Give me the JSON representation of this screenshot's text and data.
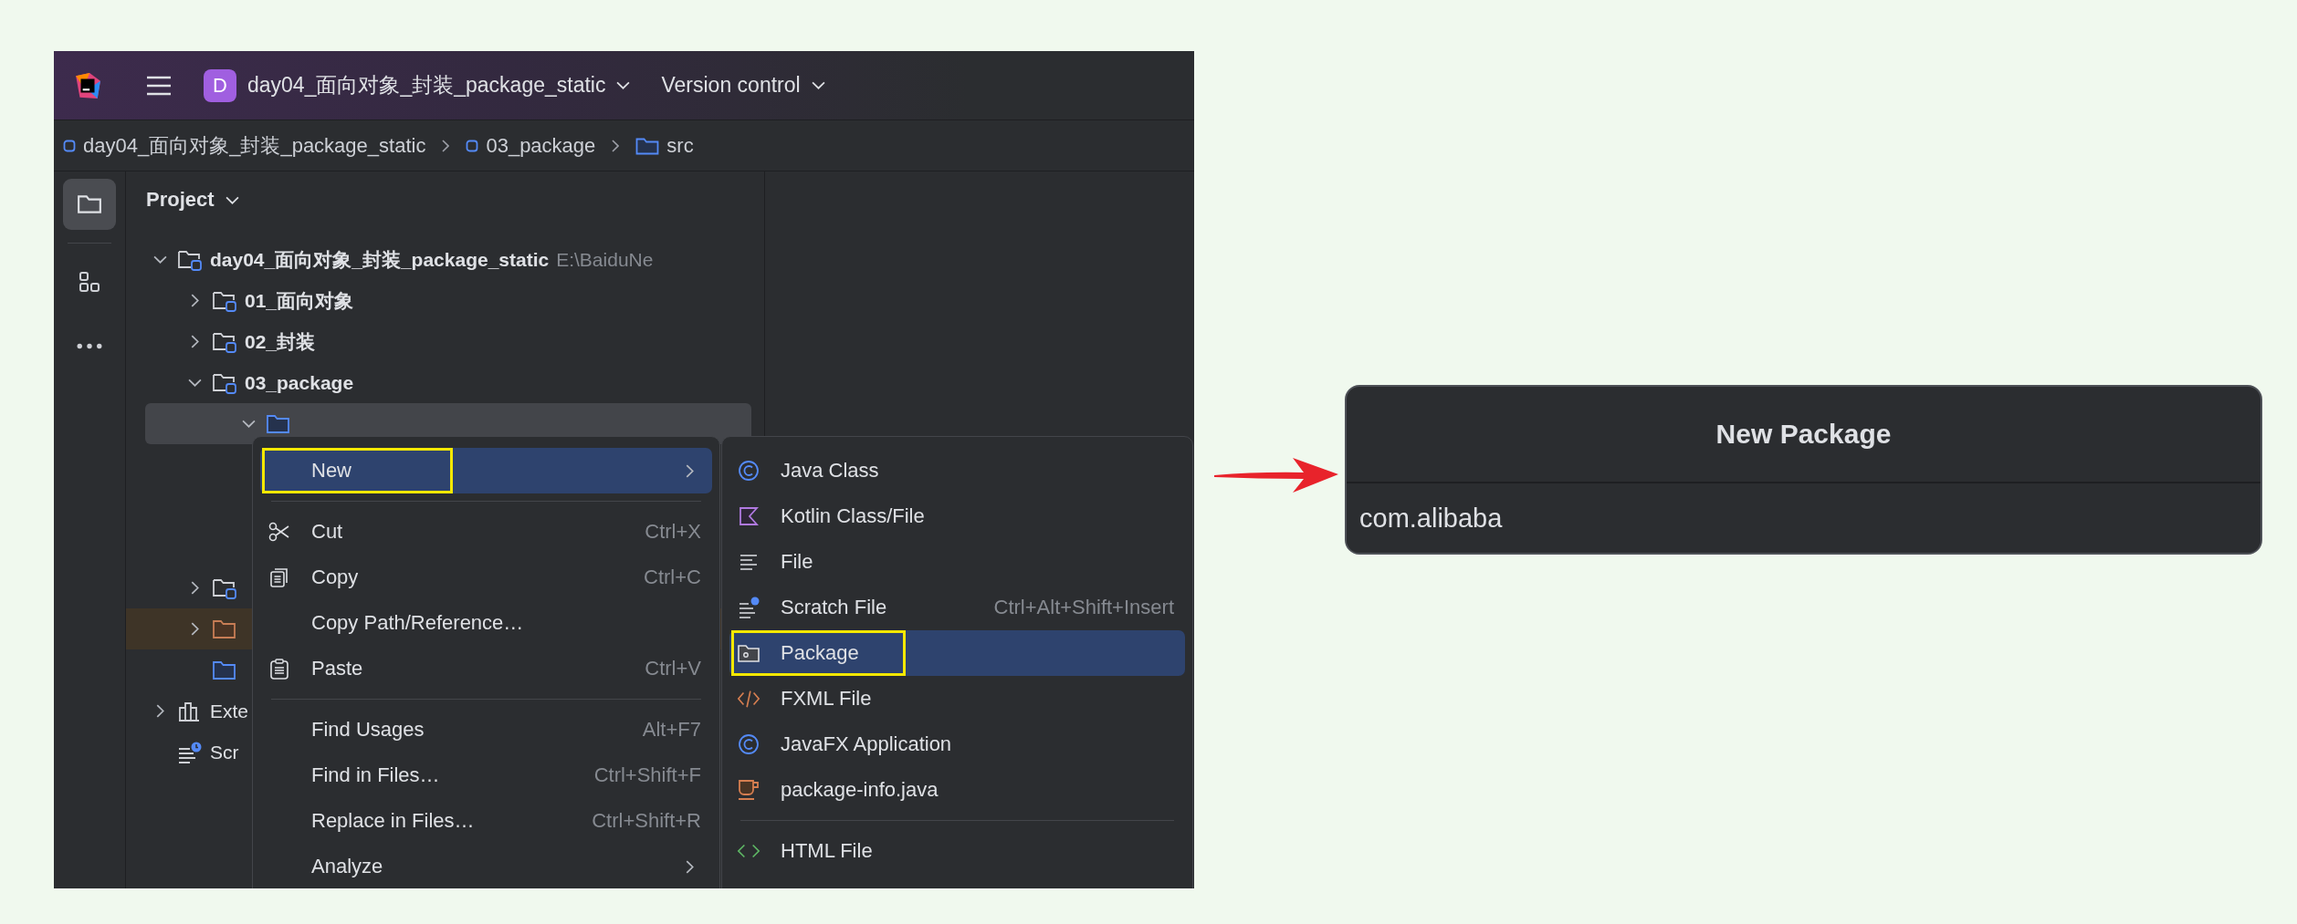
{
  "toolbar": {
    "project_badge": "D",
    "project_name": "day04_面向对象_封装_package_static",
    "vcs": "Version control"
  },
  "breadcrumbs": [
    {
      "label": "day04_面向对象_封装_package_static",
      "kind": "module"
    },
    {
      "label": "03_package",
      "kind": "module"
    },
    {
      "label": "src",
      "kind": "source"
    }
  ],
  "tool_strip": [
    {
      "kind": "project",
      "selected": true
    },
    {
      "kind": "structure",
      "selected": false
    },
    {
      "kind": "more",
      "selected": false
    }
  ],
  "panel": {
    "title": "Project"
  },
  "tree": [
    {
      "label": "day04_面向对象_封装_package_static",
      "path": "E:\\BaiduNe",
      "kind": "module",
      "expanded": true,
      "selected": false,
      "children": [
        {
          "label": "01_面向对象",
          "kind": "module",
          "expanded": false,
          "selected": false
        },
        {
          "label": "02_封装",
          "kind": "module",
          "expanded": false,
          "selected": false
        },
        {
          "label": "03_package",
          "kind": "module",
          "expanded": true,
          "selected": false,
          "children": [
            {
              "kind": "source",
              "expanded": true,
              "selected": true
            }
          ]
        },
        {
          "kind": "module",
          "expanded": false,
          "selected": false
        },
        {
          "kind": "excluded",
          "expanded": false,
          "selected": false,
          "highlighted": true
        },
        {
          "kind": "source",
          "selected": false
        }
      ]
    },
    {
      "label": "Exte",
      "kind": "libraries",
      "expanded": false,
      "selected": false
    },
    {
      "label": "Scr",
      "kind": "scratches",
      "selected": false
    }
  ],
  "context_menu": {
    "items": [
      {
        "kind": "plain",
        "label": "New",
        "submenu": true,
        "selected": true,
        "annotated": true
      },
      {
        "kind": "separator"
      },
      {
        "kind": "cut",
        "label": "Cut",
        "shortcut": "Ctrl+X",
        "submenu": false,
        "selected": false,
        "annotated": false
      },
      {
        "kind": "copy",
        "label": "Copy",
        "shortcut": "Ctrl+C",
        "submenu": false,
        "selected": false,
        "annotated": false
      },
      {
        "kind": "plain",
        "label": "Copy Path/Reference…",
        "submenu": false,
        "selected": false,
        "annotated": false
      },
      {
        "kind": "paste",
        "label": "Paste",
        "shortcut": "Ctrl+V",
        "submenu": false,
        "selected": false,
        "annotated": false
      },
      {
        "kind": "separator"
      },
      {
        "kind": "plain",
        "label": "Find Usages",
        "shortcut": "Alt+F7",
        "submenu": false,
        "selected": false,
        "annotated": false
      },
      {
        "kind": "plain",
        "label": "Find in Files…",
        "shortcut": "Ctrl+Shift+F",
        "submenu": false,
        "selected": false,
        "annotated": false
      },
      {
        "kind": "plain",
        "label": "Replace in Files…",
        "shortcut": "Ctrl+Shift+R",
        "submenu": false,
        "selected": false,
        "annotated": false
      },
      {
        "kind": "plain",
        "label": "Analyze",
        "submenu": true,
        "selected": false,
        "annotated": false
      }
    ]
  },
  "new_submenu": {
    "items": [
      {
        "kind": "java",
        "label": "Java Class",
        "selected": false,
        "annotated": false
      },
      {
        "kind": "kotlin",
        "label": "Kotlin Class/File",
        "selected": false,
        "annotated": false
      },
      {
        "kind": "file",
        "label": "File",
        "selected": false,
        "annotated": false
      },
      {
        "kind": "scratch",
        "label": "Scratch File",
        "shortcut": "Ctrl+Alt+Shift+Insert",
        "selected": false,
        "annotated": false
      },
      {
        "kind": "package",
        "label": "Package",
        "selected": true,
        "annotated": true
      },
      {
        "kind": "fxml",
        "label": "FXML File",
        "selected": false,
        "annotated": false
      },
      {
        "kind": "java",
        "label": "JavaFX Application",
        "selected": false,
        "annotated": false
      },
      {
        "kind": "info",
        "label": "package-info.java",
        "selected": false,
        "annotated": false
      },
      {
        "kind": "separator"
      },
      {
        "kind": "html",
        "label": "HTML File",
        "selected": false,
        "annotated": false
      }
    ]
  },
  "dialog": {
    "title": "New Package",
    "value": "com.alibaba"
  }
}
